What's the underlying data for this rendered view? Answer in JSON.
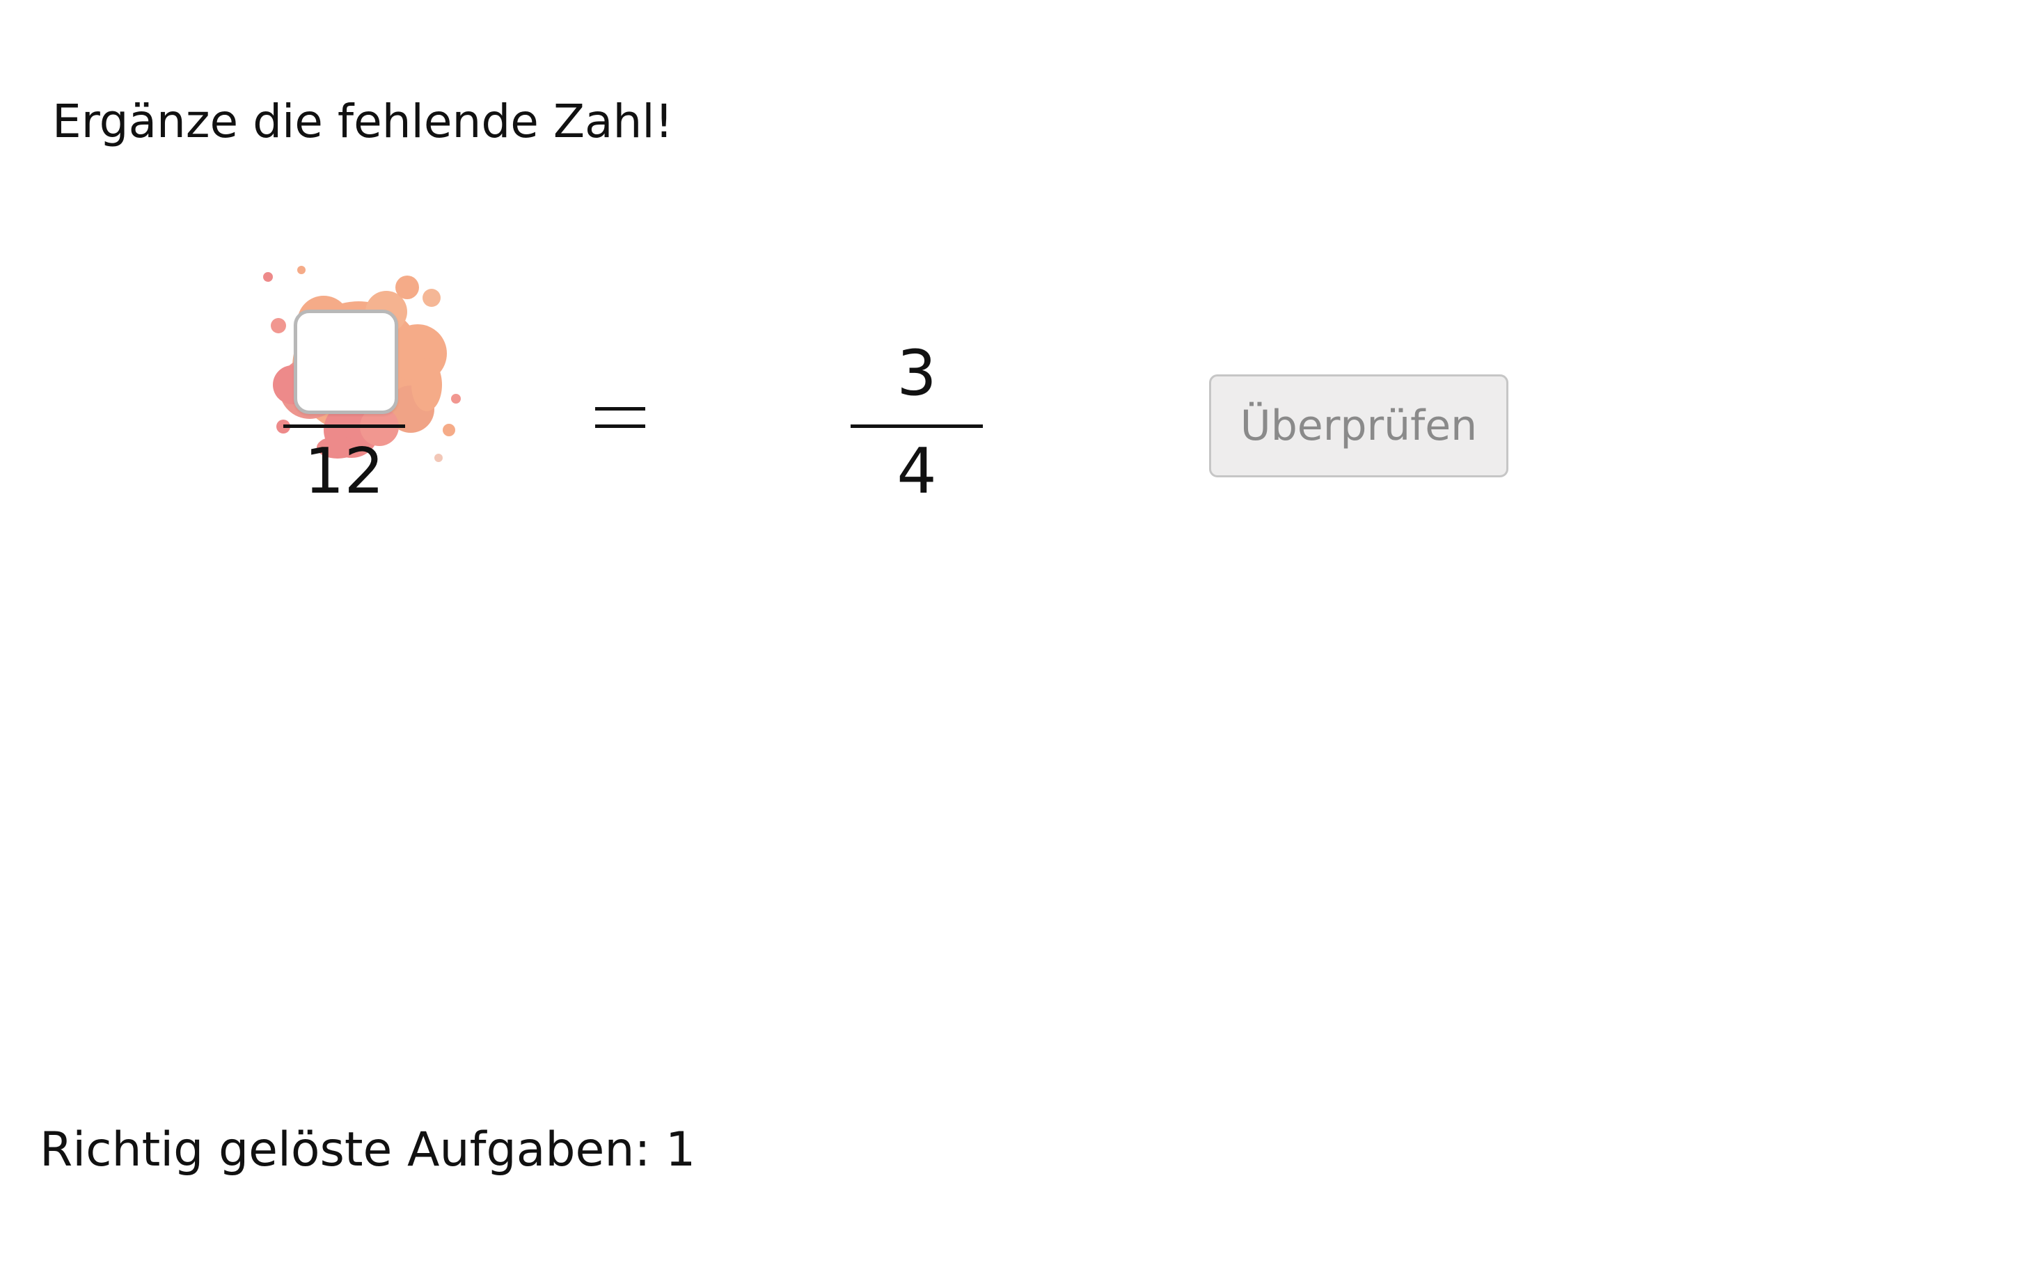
{
  "task": {
    "prompt": "Ergänze die fehlende Zahl!"
  },
  "equation": {
    "left_fraction": {
      "numerator_input_value": "",
      "denominator": "12"
    },
    "operator": "=",
    "right_fraction": {
      "numerator": "3",
      "denominator": "4"
    }
  },
  "controls": {
    "check_label": "Überprüfen"
  },
  "score": {
    "text": "Richtig gelöste Aufgaben: 1"
  },
  "colors": {
    "splash_primary": "#f4a27c",
    "splash_secondary": "#ec7e7e",
    "button_background": "#eeeded",
    "button_text": "#8a8a8a"
  },
  "icons": {
    "splash": "paint-splash-icon",
    "equals": "equals-sign-icon"
  }
}
